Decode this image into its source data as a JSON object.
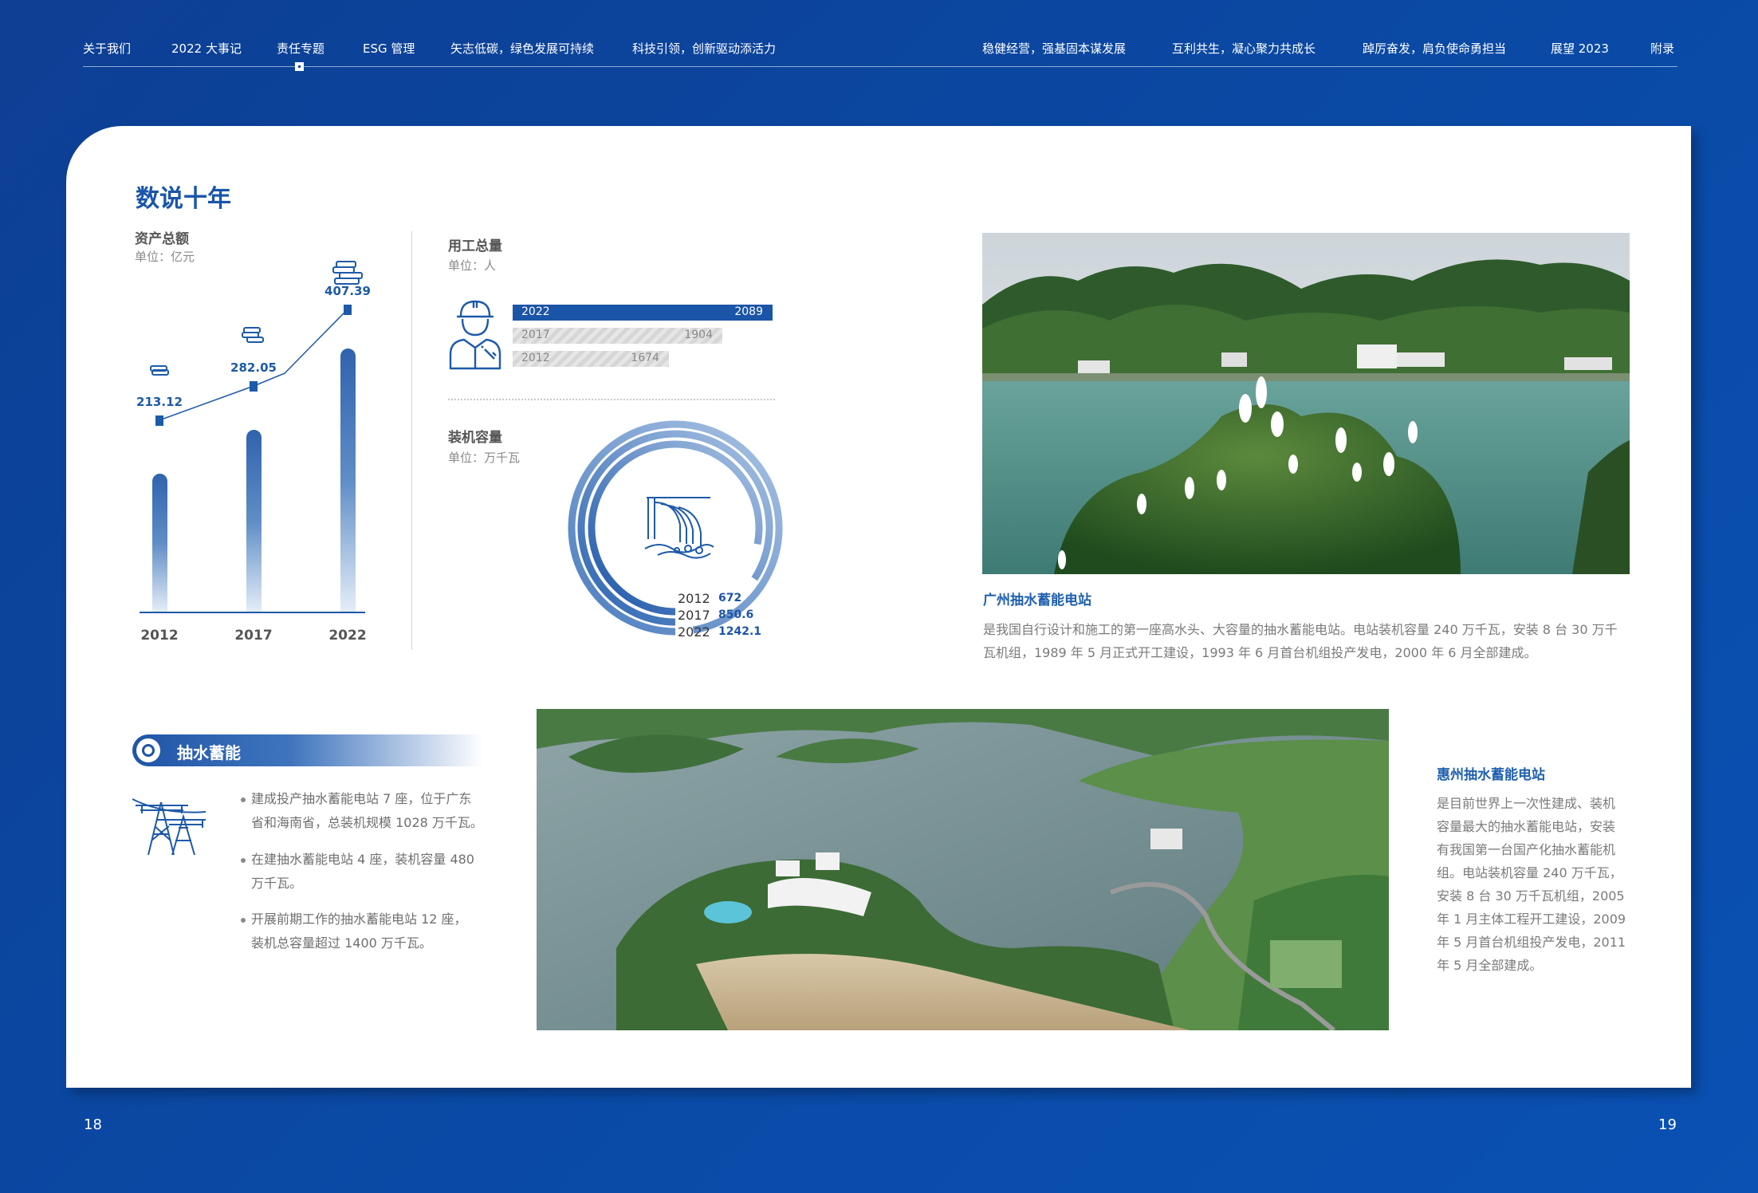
{
  "nav": {
    "items": [
      "关于我们",
      "2022 大事记",
      "责任专题",
      "ESG 管理",
      "矢志低碳，绿色发展可持续",
      "科技引领，创新驱动添活力",
      "稳健经营，强基固本谋发展",
      "互利共生，凝心聚力共成长",
      "踔厉奋发，肩负使命勇担当",
      "展望 2023",
      "附录"
    ]
  },
  "page_numbers": {
    "left": "18",
    "right": "19"
  },
  "section_title": "数说十年",
  "assets": {
    "label": "资产总额",
    "unit": "单位：亿元",
    "categories": [
      "2012",
      "2017",
      "2022"
    ],
    "values": [
      "213.12",
      "282.05",
      "407.39"
    ]
  },
  "employees": {
    "label": "用工总量",
    "unit": "单位：人",
    "rows": [
      {
        "year": "2022",
        "value": "2089"
      },
      {
        "year": "2017",
        "value": "1904"
      },
      {
        "year": "2012",
        "value": "1674"
      }
    ]
  },
  "capacity": {
    "label": "装机容量",
    "unit": "单位：万千瓦",
    "rows": [
      {
        "year": "2012",
        "value": "672"
      },
      {
        "year": "2017",
        "value": "850.6"
      },
      {
        "year": "2022",
        "value": "1242.1"
      }
    ]
  },
  "guangzhou": {
    "title": "广州抽水蓄能电站",
    "line1": "是我国自行设计和施工的第一座高水头、大容量的抽水蓄能电站。电站装机容量 240 万千瓦，安装 8 台 30 万千",
    "line2": "瓦机组，1989 年 5 月正式开工建设，1993 年 6 月首台机组投产发电，2000 年 6 月全部建成。"
  },
  "pumped": {
    "title": "抽水蓄能",
    "bullets": [
      [
        "建成投产抽水蓄能电站 7 座，位于广东",
        "省和海南省，总装机规模 1028 万千瓦。"
      ],
      [
        "在建抽水蓄能电站 4 座，装机容量 480",
        "万千瓦。"
      ],
      [
        "开展前期工作的抽水蓄能电站 12 座，",
        "装机总容量超过 1400 万千瓦。"
      ]
    ]
  },
  "huizhou": {
    "title": "惠州抽水蓄能电站",
    "lines": [
      "是目前世界上一次性建成、装机",
      "容量最大的抽水蓄能电站，安装",
      "有我国第一台国产化抽水蓄能机",
      "组。电站装机容量 240 万千瓦，",
      "安装 8 台 30 万千瓦机组，2005",
      "年 1 月主体工程开工建设，2009",
      "年 5 月首台机组投产发电，2011",
      "年 5 月全部建成。"
    ]
  },
  "chart_data": [
    {
      "type": "bar",
      "title": "资产总额",
      "ylabel": "单位：亿元",
      "categories": [
        "2012",
        "2017",
        "2022"
      ],
      "values": [
        213.12,
        282.05,
        407.39
      ]
    },
    {
      "type": "bar",
      "title": "用工总量",
      "ylabel": "单位：人",
      "categories": [
        "2022",
        "2017",
        "2012"
      ],
      "values": [
        2089,
        1904,
        1674
      ]
    },
    {
      "type": "pie",
      "title": "装机容量",
      "ylabel": "单位：万千瓦",
      "categories": [
        "2012",
        "2017",
        "2022"
      ],
      "values": [
        672,
        850.6,
        1242.1
      ]
    }
  ]
}
